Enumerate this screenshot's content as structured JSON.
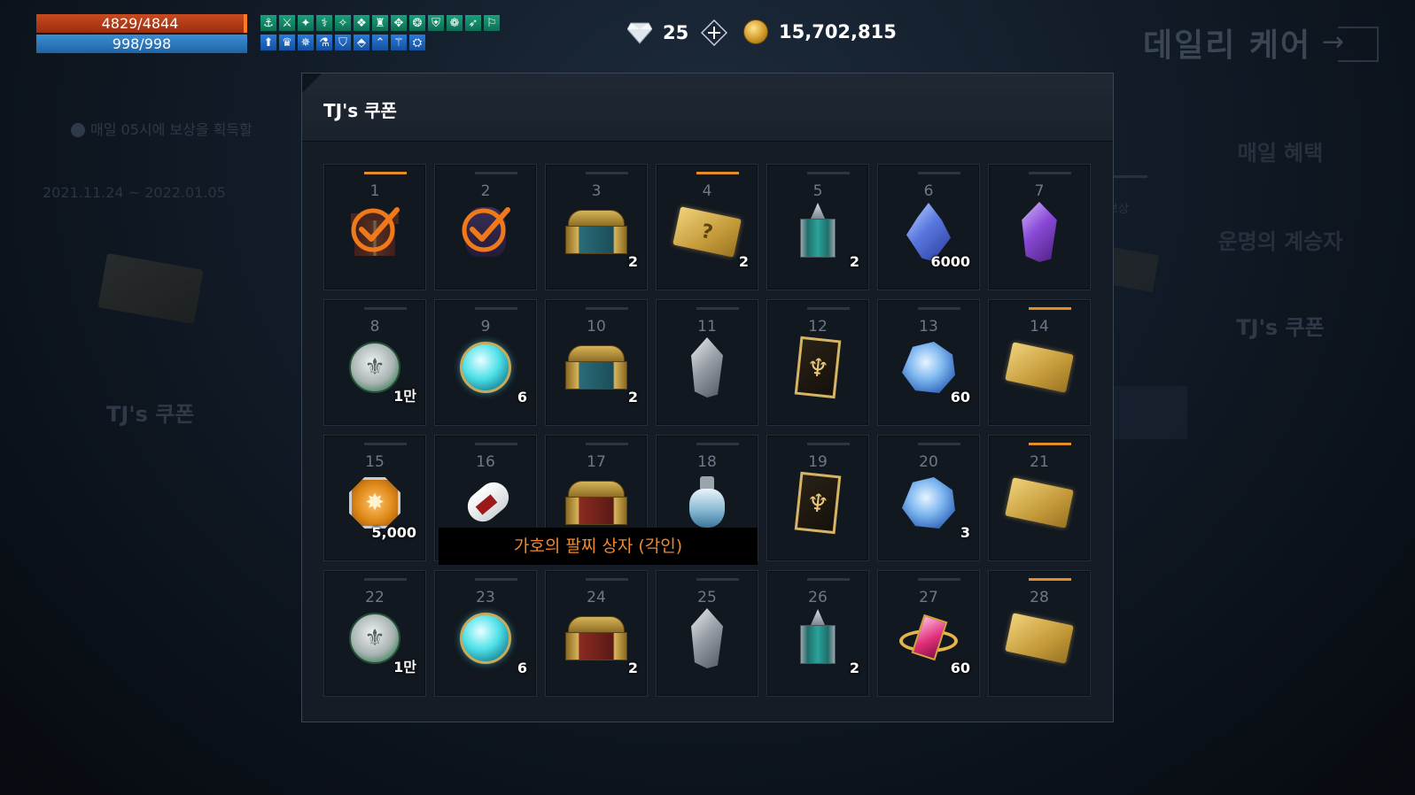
{
  "hud": {
    "hp": "4829/4844",
    "mp": "998/998",
    "buff_icons_row1": [
      "⚓",
      "⚔",
      "✦",
      "⚕",
      "✧",
      "❖",
      "♜",
      "✥",
      "❂",
      "⛨",
      "❁",
      "➶",
      "⚐"
    ],
    "buff_icons_row2": [
      "⬆",
      "♛",
      "✵",
      "⚗",
      "⛉",
      "⬘",
      "⌃",
      "⚚",
      "⛭"
    ]
  },
  "currency": {
    "diamond": "25",
    "gold": "15,702,815"
  },
  "background": {
    "title": "데일리 케어",
    "notice": "매일 05시에 보상을 획득할",
    "date": "2021.11.24 ~ 2022.01.05",
    "left_label": "TJ's 쿠폰",
    "menu": [
      "매일 혜택",
      "운명의 계승자",
      "TJ's 쿠폰"
    ],
    "small_text": "보상"
  },
  "panel": {
    "title": "TJ's 쿠폰"
  },
  "rewards": [
    {
      "day": "1",
      "icon": "gift-box",
      "qty": "",
      "claimed": true,
      "highlight": true
    },
    {
      "day": "2",
      "icon": "pouch",
      "qty": "",
      "claimed": true,
      "highlight": false
    },
    {
      "day": "3",
      "icon": "treasure-chest",
      "qty": "2",
      "claimed": false,
      "highlight": false
    },
    {
      "day": "4",
      "icon": "mystery-ticket",
      "qty": "2",
      "claimed": false,
      "highlight": true
    },
    {
      "day": "5",
      "icon": "lantern",
      "qty": "2",
      "claimed": false,
      "highlight": false
    },
    {
      "day": "6",
      "icon": "blue-crystal",
      "qty": "6000",
      "claimed": false,
      "highlight": false
    },
    {
      "day": "7",
      "icon": "purple-gem",
      "qty": "",
      "claimed": false,
      "highlight": false
    },
    {
      "day": "8",
      "icon": "silver-coin",
      "qty": "1만",
      "claimed": false,
      "highlight": false
    },
    {
      "day": "9",
      "icon": "orb",
      "qty": "6",
      "claimed": false,
      "highlight": false
    },
    {
      "day": "10",
      "icon": "treasure-chest",
      "qty": "2",
      "claimed": false,
      "highlight": false
    },
    {
      "day": "11",
      "icon": "grey-gem",
      "qty": "",
      "claimed": false,
      "highlight": false
    },
    {
      "day": "12",
      "icon": "card",
      "qty": "",
      "claimed": false,
      "highlight": false
    },
    {
      "day": "13",
      "icon": "crystal-cluster",
      "qty": "60",
      "claimed": false,
      "highlight": false
    },
    {
      "day": "14",
      "icon": "gold-ticket",
      "qty": "",
      "claimed": false,
      "highlight": true
    },
    {
      "day": "15",
      "icon": "medal",
      "qty": "5,000",
      "claimed": false,
      "highlight": false
    },
    {
      "day": "16",
      "icon": "scroll",
      "qty": "",
      "claimed": false,
      "highlight": false
    },
    {
      "day": "17",
      "icon": "red-chest",
      "qty": "",
      "claimed": false,
      "highlight": false
    },
    {
      "day": "18",
      "icon": "potion",
      "qty": "",
      "claimed": false,
      "highlight": false
    },
    {
      "day": "19",
      "icon": "card",
      "qty": "",
      "claimed": false,
      "highlight": false
    },
    {
      "day": "20",
      "icon": "crystal-cluster",
      "qty": "3",
      "claimed": false,
      "highlight": false
    },
    {
      "day": "21",
      "icon": "gold-ticket",
      "qty": "",
      "claimed": false,
      "highlight": true
    },
    {
      "day": "22",
      "icon": "silver-coin",
      "qty": "1만",
      "claimed": false,
      "highlight": false
    },
    {
      "day": "23",
      "icon": "orb",
      "qty": "6",
      "claimed": false,
      "highlight": false
    },
    {
      "day": "24",
      "icon": "red-chest",
      "qty": "2",
      "claimed": false,
      "highlight": false
    },
    {
      "day": "25",
      "icon": "grey-gem",
      "qty": "",
      "claimed": false,
      "highlight": false
    },
    {
      "day": "26",
      "icon": "lantern",
      "qty": "2",
      "claimed": false,
      "highlight": false
    },
    {
      "day": "27",
      "icon": "pink-gem-ring",
      "qty": "60",
      "claimed": false,
      "highlight": false
    },
    {
      "day": "28",
      "icon": "gold-ticket",
      "qty": "",
      "claimed": false,
      "highlight": true
    }
  ],
  "tooltip": {
    "text": "가호의 팔찌 상자 (각인)"
  },
  "colors": {
    "accent_orange": "#e48d26",
    "tooltip_text": "#f0882e",
    "hp": "#c84a20",
    "mp": "#3b8ed4"
  }
}
